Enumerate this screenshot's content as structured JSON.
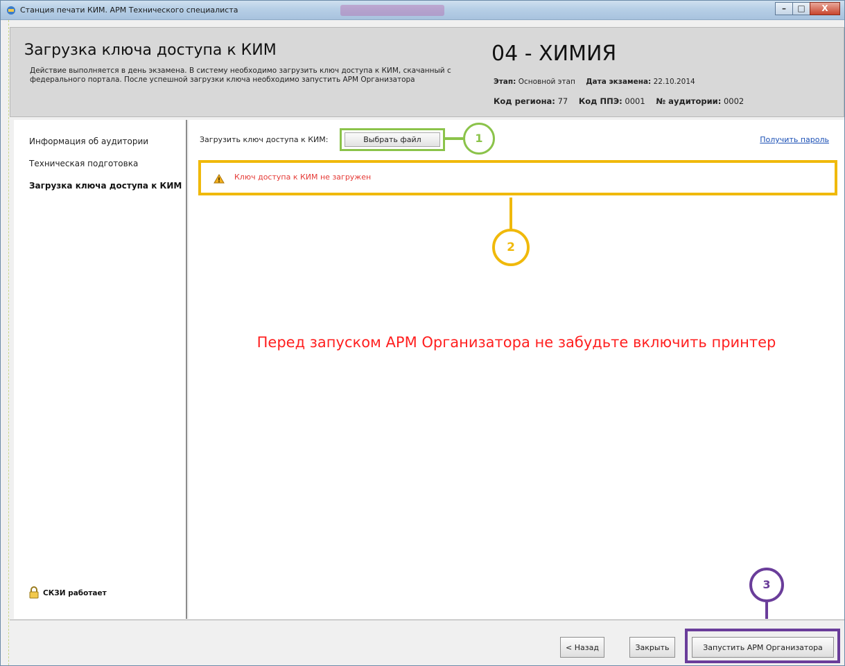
{
  "window": {
    "title": "Станция печати КИМ. АРМ Технического специалиста",
    "min_glyph": "–",
    "max_glyph": "□",
    "close_glyph": "X"
  },
  "header": {
    "title": "Загрузка ключа доступа к КИМ",
    "description": "Действие выполняется в день экзамена. В систему необходимо загрузить ключ доступа к КИМ, скачанный с федерального портала. После успешной загрузки ключа необходимо запустить АРМ Организатора",
    "subject": "04 - ХИМИЯ",
    "stage_label": "Этап:",
    "stage_value": "Основной этап",
    "date_label": "Дата экзамена:",
    "date_value": "22.10.2014",
    "region_label": "Код региона:",
    "region_value": "77",
    "ppe_label": "Код ППЭ:",
    "ppe_value": "0001",
    "room_label": "№ аудитории:",
    "room_value": "0002"
  },
  "sidebar": {
    "items": [
      {
        "label": "Информация об аудитории"
      },
      {
        "label": "Техническая подготовка"
      },
      {
        "label": "Загрузка ключа доступа к КИМ"
      }
    ],
    "skzi_status": "СКЗИ работает"
  },
  "main": {
    "load_label": "Загрузить ключ доступа к КИМ:",
    "choose_file": "Выбрать файл",
    "get_password": "Получить пароль",
    "warning": "Ключ доступа к КИМ не загружен",
    "printer_note": "Перед запуском АРМ Организатора не забудьте включить принтер",
    "callouts": [
      "1",
      "2",
      "3"
    ]
  },
  "footer": {
    "back": "< Назад",
    "close": "Закрыть",
    "launch": "Запустить АРМ Организатора"
  },
  "colors": {
    "callout1": "#8bc34a",
    "callout2": "#f0b90b",
    "callout3": "#6a3d9a",
    "warning_text": "#e53935",
    "printer_note": "#ff1f1f",
    "link": "#1a4fb5"
  },
  "icons": {
    "app": "app-icon",
    "warning": "warning-triangle-icon",
    "lock": "lock-icon"
  }
}
